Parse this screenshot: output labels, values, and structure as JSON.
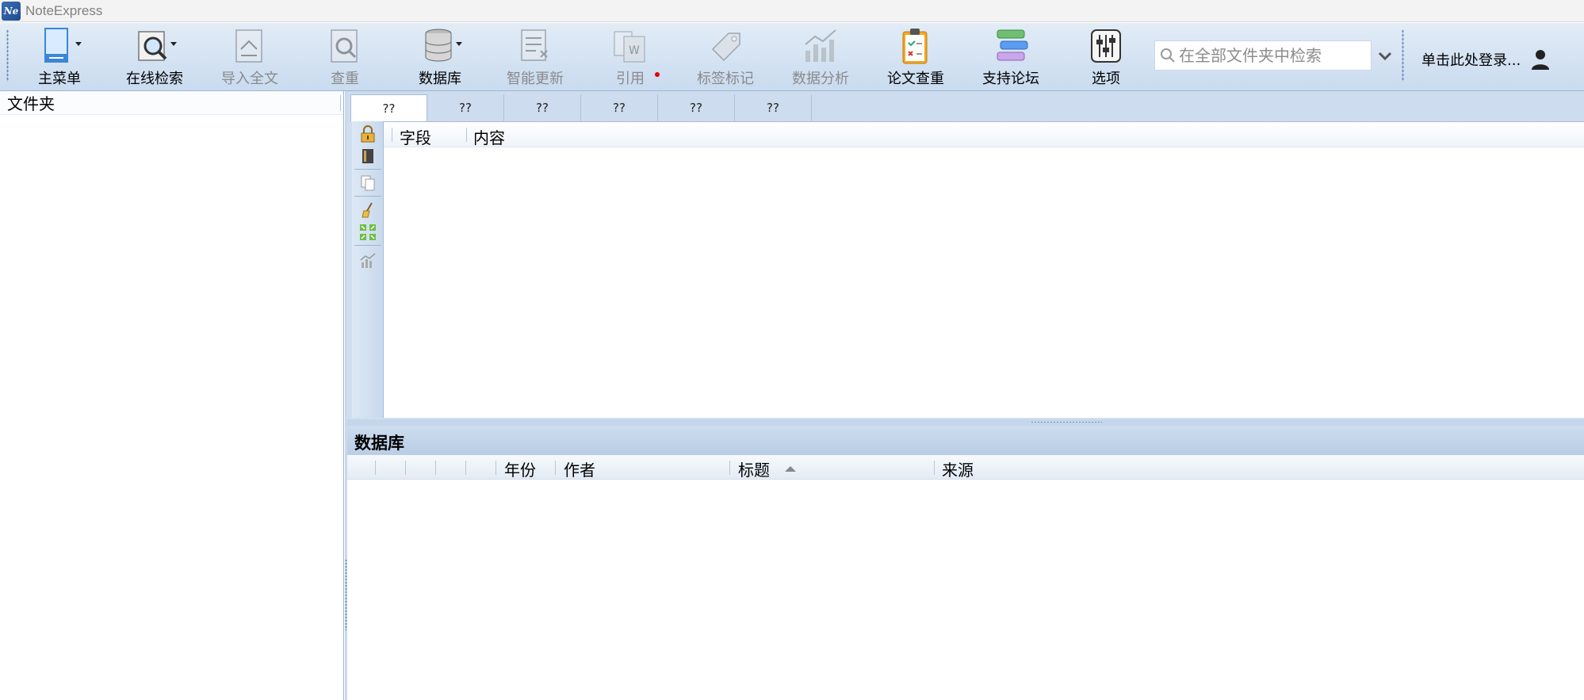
{
  "window": {
    "title": "NoteExpress",
    "logo_text": "NE"
  },
  "toolbar": {
    "items": [
      {
        "label": "主菜单",
        "icon": "main-menu-icon",
        "enabled": true,
        "dropdown": true
      },
      {
        "label": "在线检索",
        "icon": "online-search-icon",
        "enabled": true,
        "dropdown": true
      },
      {
        "label": "导入全文",
        "icon": "import-fulltext-icon",
        "enabled": false
      },
      {
        "label": "查重",
        "icon": "duplicate-check-icon",
        "enabled": false
      },
      {
        "label": "数据库",
        "icon": "database-icon",
        "enabled": true,
        "dropdown": true
      },
      {
        "label": "智能更新",
        "icon": "smart-update-icon",
        "enabled": false
      },
      {
        "label": "引用",
        "icon": "cite-icon",
        "enabled": false,
        "has_dot": true
      },
      {
        "label": "标签标记",
        "icon": "tag-icon",
        "enabled": false
      },
      {
        "label": "数据分析",
        "icon": "data-analysis-icon",
        "enabled": false
      },
      {
        "label": "论文查重",
        "icon": "paper-check-icon",
        "enabled": true
      },
      {
        "label": "支持论坛",
        "icon": "forum-icon",
        "enabled": true
      },
      {
        "label": "选项",
        "icon": "options-icon",
        "enabled": true
      }
    ],
    "search": {
      "placeholder": "在全部文件夹中检索",
      "value": ""
    },
    "login_text": "单击此处登录..."
  },
  "left_panel": {
    "header": "文件夹"
  },
  "detail": {
    "tabs": [
      "??",
      "??",
      "??",
      "??",
      "??",
      "??"
    ],
    "active_tab": 0,
    "columns": [
      "字段",
      "内容"
    ]
  },
  "database": {
    "title": "数据库",
    "columns": [
      "年份",
      "作者",
      "标题",
      "来源"
    ],
    "sort_column": "标题",
    "sort_direction": "ascending"
  },
  "colors": {
    "toolbar_top": "#e2ecf7",
    "toolbar_bottom": "#c9dbef",
    "panel_blue": "#cddcee",
    "accent": "#1d4b8f"
  }
}
